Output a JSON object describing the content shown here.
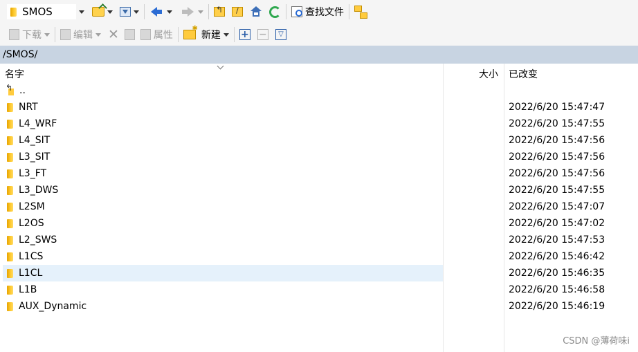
{
  "toolbar1": {
    "drive_label": "SMOS",
    "find_files_label": "查找文件"
  },
  "toolbar2": {
    "download_label": "下载",
    "edit_label": "编辑",
    "properties_label": "属性",
    "new_label": "新建"
  },
  "path": "/SMOS/",
  "columns": {
    "name": "名字",
    "size": "大小",
    "modified": "已改变"
  },
  "rows": [
    {
      "name": "..",
      "date": ""
    },
    {
      "name": "NRT",
      "date": "2022/6/20 15:47:47"
    },
    {
      "name": "L4_WRF",
      "date": "2022/6/20 15:47:55"
    },
    {
      "name": "L4_SIT",
      "date": "2022/6/20 15:47:56"
    },
    {
      "name": "L3_SIT",
      "date": "2022/6/20 15:47:56"
    },
    {
      "name": "L3_FT",
      "date": "2022/6/20 15:47:56"
    },
    {
      "name": "L3_DWS",
      "date": "2022/6/20 15:47:55"
    },
    {
      "name": "L2SM",
      "date": "2022/6/20 15:47:07"
    },
    {
      "name": "L2OS",
      "date": "2022/6/20 15:47:02"
    },
    {
      "name": "L2_SWS",
      "date": "2022/6/20 15:47:53"
    },
    {
      "name": "L1CS",
      "date": "2022/6/20 15:46:42"
    },
    {
      "name": "L1CL",
      "date": "2022/6/20 15:46:35"
    },
    {
      "name": "L1B",
      "date": "2022/6/20 15:46:58"
    },
    {
      "name": "AUX_Dynamic",
      "date": "2022/6/20 15:46:19"
    }
  ],
  "selected_row": "L1CL",
  "watermark": "CSDN @薄荷味i",
  "colors": {
    "path_bar": "#c8d4e2",
    "selection": "#e5f1fb",
    "folder": "#ffcb3d"
  }
}
